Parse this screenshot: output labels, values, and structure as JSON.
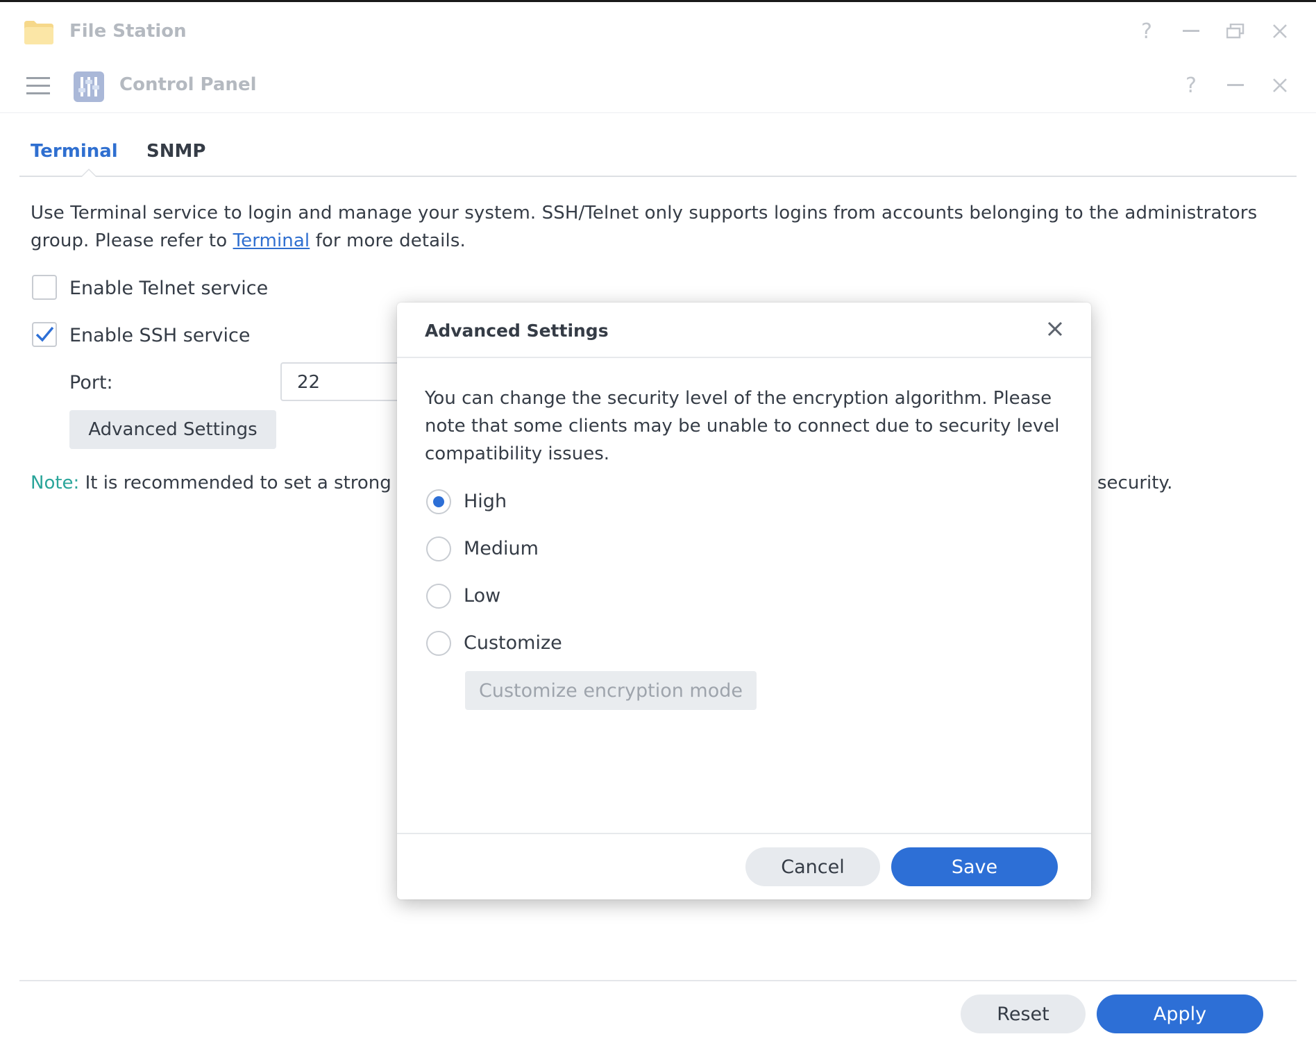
{
  "file_station": {
    "title": "File Station",
    "help_icon": "question-icon",
    "minimize_icon": "minimize-icon",
    "restore_icon": "restore-icon",
    "close_icon": "close-icon"
  },
  "control_panel": {
    "title": "Control Panel"
  },
  "tabs": [
    {
      "label": "Terminal",
      "active": true
    },
    {
      "label": "SNMP",
      "active": false
    }
  ],
  "terminal": {
    "description_before_link": "Use Terminal service to login and manage your system. SSH/Telnet only supports logins from accounts belonging to the administrators group. Please refer to ",
    "description_link": "Terminal",
    "description_after_link": " for more details.",
    "telnet_label": "Enable Telnet service",
    "telnet_checked": false,
    "ssh_label": "Enable SSH service",
    "ssh_checked": true,
    "port_label": "Port:",
    "port_value": "22",
    "advanced_button": "Advanced Settings",
    "note_label": "Note:",
    "note_text": " It is recommended to set a strong",
    "note_end": "security."
  },
  "footer": {
    "reset": "Reset",
    "apply": "Apply"
  },
  "modal": {
    "title": "Advanced Settings",
    "description": "You can change the security level of the encryption algorithm. Please note that some clients may be unable to connect due to security level compatibility issues.",
    "options": [
      {
        "label": "High",
        "selected": true
      },
      {
        "label": "Medium",
        "selected": false
      },
      {
        "label": "Low",
        "selected": false
      },
      {
        "label": "Customize",
        "selected": false
      }
    ],
    "customize_button": "Customize encryption mode",
    "cancel": "Cancel",
    "save": "Save"
  },
  "colors": {
    "accent": "#2d6fd6",
    "note": "#2aa59a",
    "text": "#353c46",
    "muted": "#b4b9c0"
  }
}
